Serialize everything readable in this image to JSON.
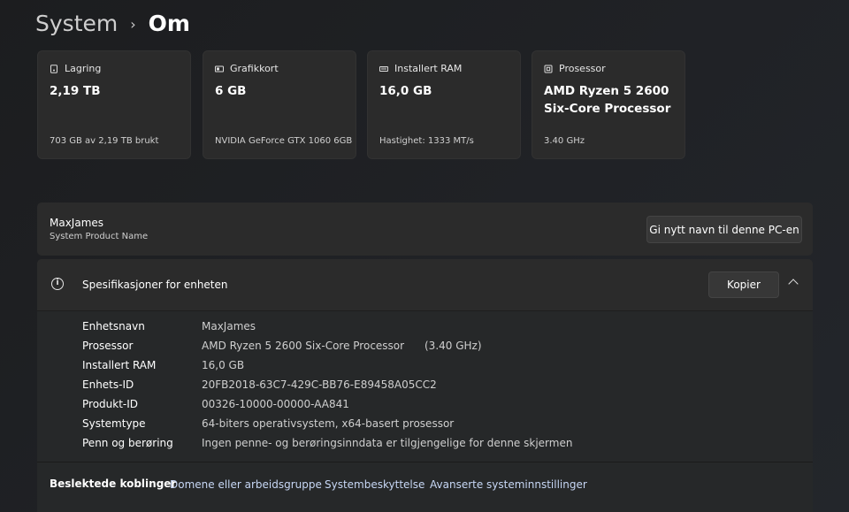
{
  "breadcrumb": {
    "parent": "System",
    "separator": "›",
    "current": "Om"
  },
  "cards": [
    {
      "icon": "storage-icon",
      "label": "Lagring",
      "value": "2,19 TB",
      "sub": "703 GB av 2,19 TB brukt"
    },
    {
      "icon": "graphics-card-icon",
      "label": "Grafikkort",
      "value": "6 GB",
      "sub": "NVIDIA GeForce GTX 1060 6GB"
    },
    {
      "icon": "memory-icon",
      "label": "Installert RAM",
      "value": "16,0 GB",
      "sub": "Hastighet: 1333 MT/s"
    },
    {
      "icon": "processor-icon",
      "label": "Prosessor",
      "value": "AMD Ryzen 5 2600 Six-Core Processor",
      "sub": "3.40 GHz"
    }
  ],
  "pc": {
    "name": "MaxJames",
    "model": "System Product Name",
    "rename_button": "Gi nytt navn til denne PC-en"
  },
  "specs": {
    "title": "Spesifikasjoner for enheten",
    "info_glyph": "i",
    "copy_button": "Kopier",
    "rows": [
      {
        "key": "Enhetsnavn",
        "value": "MaxJames"
      },
      {
        "key": "Prosessor",
        "value": "AMD Ryzen 5 2600 Six-Core Processor",
        "extra": "(3.40 GHz)"
      },
      {
        "key": "Installert RAM",
        "value": "16,0 GB"
      },
      {
        "key": "Enhets-ID",
        "value": "20FB2018-63C7-429C-BB76-E89458A05CC2"
      },
      {
        "key": "Produkt-ID",
        "value": "00326-10000-00000-AA841"
      },
      {
        "key": "Systemtype",
        "value": "64-biters operativsystem, x64-basert prosessor"
      },
      {
        "key": "Penn og berøring",
        "value": "Ingen penne- og berøringsinndata er tilgjengelige for denne skjermen"
      }
    ]
  },
  "related_links": {
    "label": "Beslektede koblinger",
    "items": [
      "Domene eller arbeidsgruppe",
      "Systembeskyttelse",
      "Avanserte systeminnstillinger"
    ]
  }
}
